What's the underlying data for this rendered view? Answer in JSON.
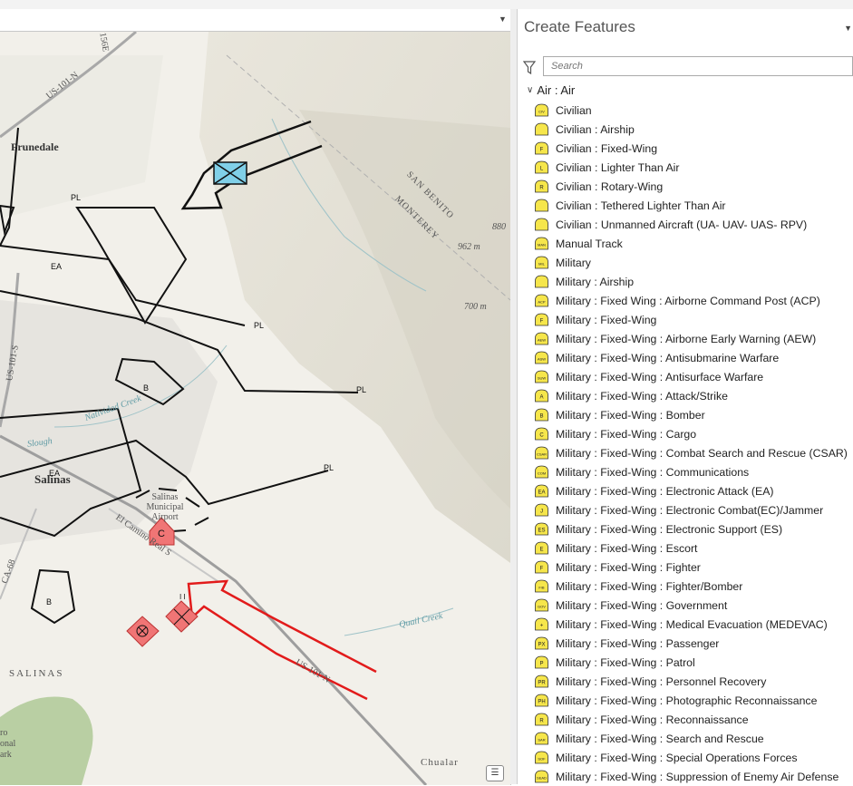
{
  "map": {
    "place_labels": [
      {
        "name": "prunedale",
        "text": "Prunedale"
      },
      {
        "name": "salinas",
        "text": "Salinas"
      },
      {
        "name": "salinas-area",
        "text": "SALINAS"
      },
      {
        "name": "airport",
        "text": "Salinas Municipal Airport"
      },
      {
        "name": "chualar",
        "text": "Chualar"
      },
      {
        "name": "san-benito",
        "text": "SAN BENITO"
      },
      {
        "name": "monterey",
        "text": "MONTEREY"
      },
      {
        "name": "elev-962",
        "text": "962 m"
      },
      {
        "name": "elev-700",
        "text": "700 m"
      },
      {
        "name": "elev-880",
        "text": "880"
      },
      {
        "name": "quail-creek",
        "text": "Quail Creek"
      },
      {
        "name": "natividad-creek",
        "text": "Natividad Creek"
      },
      {
        "name": "slough",
        "text": "Slough"
      },
      {
        "name": "el-camino",
        "text": "El Camino Real S"
      },
      {
        "name": "us101n-top",
        "text": "US-101-N"
      },
      {
        "name": "us101s",
        "text": "US-101-S"
      },
      {
        "name": "us101n-bottom",
        "text": "US-101-N"
      },
      {
        "name": "ca68",
        "text": "CA-68"
      },
      {
        "name": "road156",
        "text": "156E"
      },
      {
        "name": "park",
        "text": "ro onal ark"
      }
    ],
    "unit_labels": {
      "pl": "PL",
      "ea": "EA",
      "b": "B",
      "c": "C",
      "ii": "I I"
    },
    "colors": {
      "symbol_fill": "#f07575",
      "friendly_fill": "#80d0e8",
      "phase_line": "#111111",
      "route": "#e02020"
    }
  },
  "panel": {
    "title": "Create Features",
    "search_placeholder": "Search",
    "group_label": "Air : Air",
    "items": [
      {
        "label": "Civilian",
        "code": "CIV"
      },
      {
        "label": "Civilian : Airship",
        "code": ""
      },
      {
        "label": "Civilian : Fixed-Wing",
        "code": "F"
      },
      {
        "label": "Civilian : Lighter Than Air",
        "code": "L"
      },
      {
        "label": "Civilian : Rotary-Wing",
        "code": "R"
      },
      {
        "label": "Civilian : Tethered Lighter Than Air",
        "code": ""
      },
      {
        "label": "Civilian : Unmanned Aircraft (UA- UAV- UAS- RPV)",
        "code": ""
      },
      {
        "label": "Manual Track",
        "code": "MAN"
      },
      {
        "label": "Military",
        "code": "MIL"
      },
      {
        "label": "Military : Airship",
        "code": ""
      },
      {
        "label": "Military : Fixed Wing : Airborne Command Post (ACP)",
        "code": "ACP"
      },
      {
        "label": "Military : Fixed-Wing",
        "code": "F"
      },
      {
        "label": "Military : Fixed-Wing : Airborne Early Warning (AEW)",
        "code": "AEW"
      },
      {
        "label": "Military : Fixed-Wing : Antisubmarine Warfare",
        "code": "ASW"
      },
      {
        "label": "Military : Fixed-Wing : Antisurface Warfare",
        "code": "SUW"
      },
      {
        "label": "Military : Fixed-Wing : Attack/Strike",
        "code": "A"
      },
      {
        "label": "Military : Fixed-Wing : Bomber",
        "code": "B"
      },
      {
        "label": "Military : Fixed-Wing : Cargo",
        "code": "C"
      },
      {
        "label": "Military : Fixed-Wing : Combat Search and Rescue (CSAR)",
        "code": "CSAR"
      },
      {
        "label": "Military : Fixed-Wing : Communications",
        "code": "COM"
      },
      {
        "label": "Military : Fixed-Wing : Electronic Attack (EA)",
        "code": "EA"
      },
      {
        "label": "Military : Fixed-Wing : Electronic Combat(EC)/Jammer",
        "code": "J"
      },
      {
        "label": "Military : Fixed-Wing : Electronic Support (ES)",
        "code": "ES"
      },
      {
        "label": "Military : Fixed-Wing : Escort",
        "code": "E"
      },
      {
        "label": "Military : Fixed-Wing : Fighter",
        "code": "F"
      },
      {
        "label": "Military : Fixed-Wing : Fighter/Bomber",
        "code": "F/B"
      },
      {
        "label": "Military : Fixed-Wing : Government",
        "code": "GOV"
      },
      {
        "label": "Military : Fixed-Wing : Medical Evacuation (MEDEVAC)",
        "code": "+"
      },
      {
        "label": "Military : Fixed-Wing : Passenger",
        "code": "PX"
      },
      {
        "label": "Military : Fixed-Wing : Patrol",
        "code": "P"
      },
      {
        "label": "Military : Fixed-Wing : Personnel Recovery",
        "code": "PR"
      },
      {
        "label": "Military : Fixed-Wing : Photographic Reconnaissance",
        "code": "PH"
      },
      {
        "label": "Military : Fixed-Wing : Reconnaissance",
        "code": "R"
      },
      {
        "label": "Military : Fixed-Wing : Search and Rescue",
        "code": "SAR"
      },
      {
        "label": "Military : Fixed-Wing : Special Operations Forces",
        "code": "SOF"
      },
      {
        "label": "Military : Fixed-Wing : Suppression of Enemy Air Defense",
        "code": "SEAD"
      }
    ]
  }
}
